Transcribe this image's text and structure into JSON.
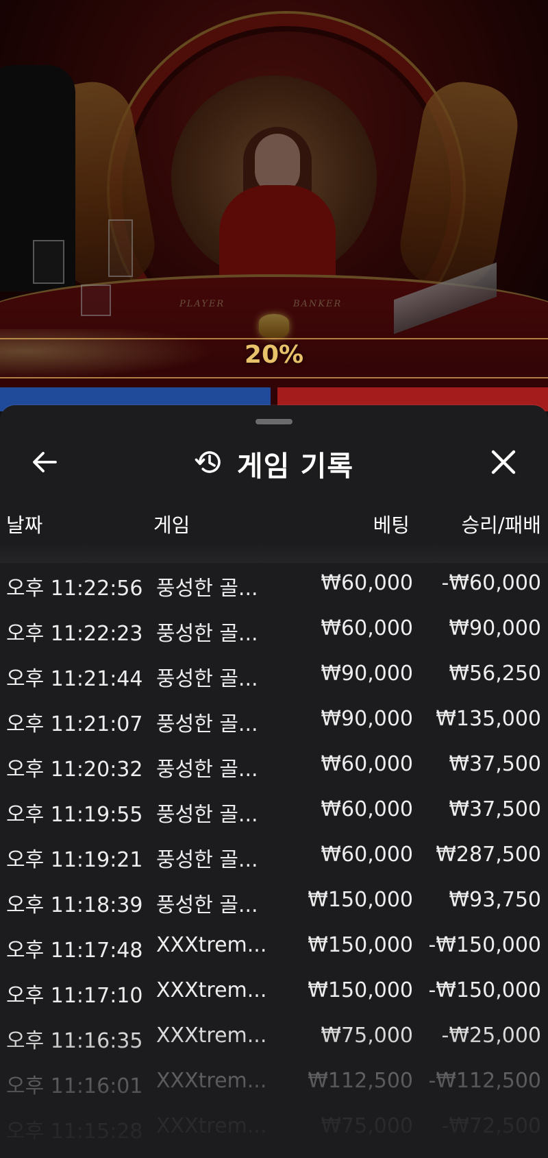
{
  "video": {
    "multiplier": "20%",
    "player_label": "PLAYER",
    "banker_label": "BANKER"
  },
  "sheet": {
    "title": "게임 기록",
    "icons": {
      "back": "arrow-left-icon",
      "history": "history-clock-icon",
      "close": "close-icon"
    },
    "columns": {
      "date": "날짜",
      "game": "게임",
      "bet": "베팅",
      "result": "승리/패배"
    },
    "rows": [
      {
        "date": "오후 11:22:56",
        "game": "풍성한 골...",
        "bet": "₩60,000",
        "result": "-₩60,000"
      },
      {
        "date": "오후 11:22:23",
        "game": "풍성한 골...",
        "bet": "₩60,000",
        "result": "₩90,000"
      },
      {
        "date": "오후 11:21:44",
        "game": "풍성한 골...",
        "bet": "₩90,000",
        "result": "₩56,250"
      },
      {
        "date": "오후 11:21:07",
        "game": "풍성한 골...",
        "bet": "₩90,000",
        "result": "₩135,000"
      },
      {
        "date": "오후 11:20:32",
        "game": "풍성한 골...",
        "bet": "₩60,000",
        "result": "₩37,500"
      },
      {
        "date": "오후 11:19:55",
        "game": "풍성한 골...",
        "bet": "₩60,000",
        "result": "₩37,500"
      },
      {
        "date": "오후 11:19:21",
        "game": "풍성한 골...",
        "bet": "₩60,000",
        "result": "₩287,500"
      },
      {
        "date": "오후 11:18:39",
        "game": "풍성한 골...",
        "bet": "₩150,000",
        "result": "₩93,750"
      },
      {
        "date": "오후 11:17:48",
        "game": "XXXtrem...",
        "bet": "₩150,000",
        "result": "-₩150,000"
      },
      {
        "date": "오후 11:17:10",
        "game": "XXXtrem...",
        "bet": "₩150,000",
        "result": "-₩150,000"
      },
      {
        "date": "오후 11:16:35",
        "game": "XXXtrem...",
        "bet": "₩75,000",
        "result": "-₩25,000"
      },
      {
        "date": "오후 11:16:01",
        "game": "XXXtrem...",
        "bet": "₩112,500",
        "result": "-₩112,500"
      },
      {
        "date": "오후 11:15:28",
        "game": "XXXtrem...",
        "bet": "₩75,000",
        "result": "-₩72,500"
      }
    ]
  },
  "colors": {
    "sheet_bg": "#1c1c1e",
    "text": "#ededed",
    "gold": "#e8c26a"
  }
}
